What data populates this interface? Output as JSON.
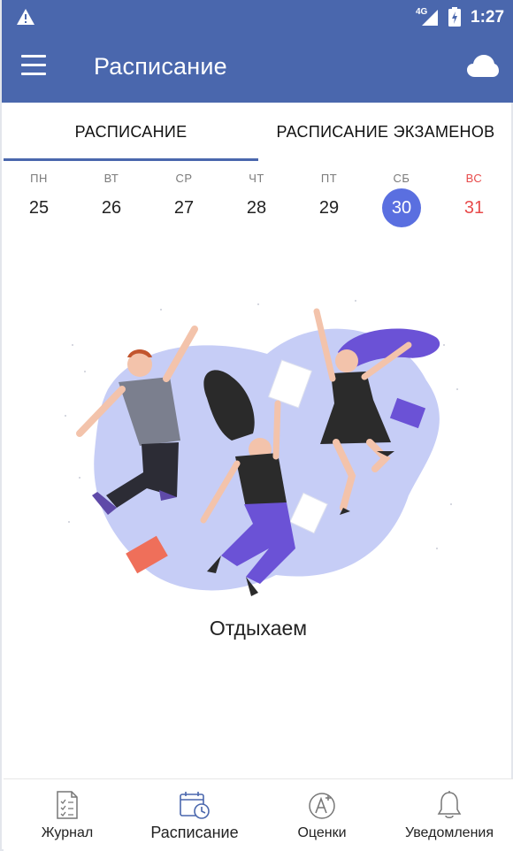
{
  "status_bar": {
    "network": "4G",
    "time": "1:27",
    "icons": [
      "warning-icon",
      "signal-icon",
      "battery-charging-icon"
    ]
  },
  "app_bar": {
    "title": "Расписание",
    "menu_icon": "hamburger-menu-icon",
    "action_icon": "cloud-icon"
  },
  "tabs": [
    {
      "label": "РАСПИСАНИЕ",
      "active": true
    },
    {
      "label": "РАСПИСАНИЕ ЭКЗАМЕНОВ",
      "active": false
    }
  ],
  "week": {
    "days": [
      {
        "dow": "ПН",
        "num": "25"
      },
      {
        "dow": "ВТ",
        "num": "26"
      },
      {
        "dow": "СР",
        "num": "27"
      },
      {
        "dow": "ЧТ",
        "num": "28"
      },
      {
        "dow": "ПТ",
        "num": "29"
      },
      {
        "dow": "СБ",
        "num": "30",
        "selected": true
      },
      {
        "dow": "ВС",
        "num": "31",
        "sunday": true
      }
    ],
    "selected_color": "#5a6fe0",
    "sunday_color": "#e84b4b"
  },
  "empty_state": {
    "message": "Отдыхаем",
    "illustration": "jumping-people-illustration"
  },
  "bottom_nav": [
    {
      "label": "Журнал",
      "icon": "journal-icon",
      "active": false
    },
    {
      "label": "Расписание",
      "icon": "calendar-clock-icon",
      "active": true
    },
    {
      "label": "Оценки",
      "icon": "grade-a-plus-icon",
      "active": false
    },
    {
      "label": "Уведомления",
      "icon": "bell-icon",
      "active": false
    }
  ],
  "colors": {
    "primary": "#4a67ad",
    "accent": "#5a6fe0"
  }
}
